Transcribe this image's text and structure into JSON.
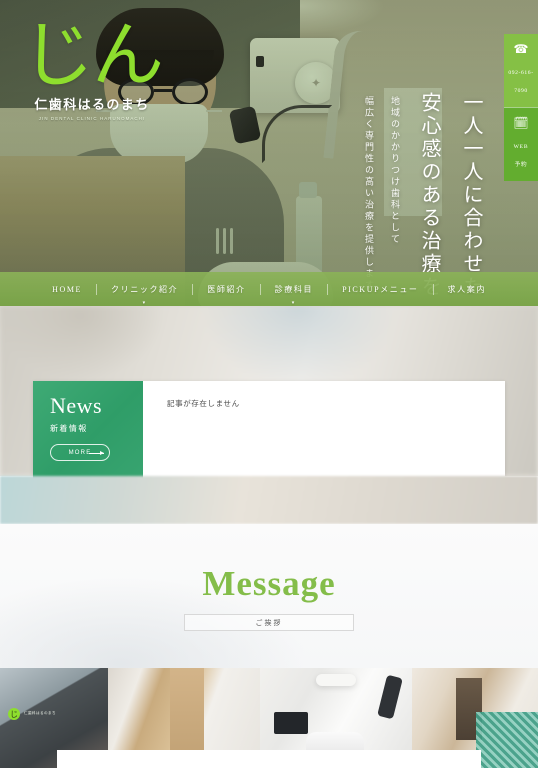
{
  "site": {
    "logo_mark": "じん",
    "clinic_name": "仁歯科はるのまち",
    "clinic_name_roman": "JIN DENTAL CLINIC HARUNOMACHI"
  },
  "hero": {
    "headline_main": "一人一人に合わせた",
    "headline_sub": "安心感のある治療を",
    "lead_line1": "地域のかかりつけ歯科として",
    "lead_line2": "幅広く専門性の高い治療を提供します"
  },
  "rail": {
    "tel_icon": "phone-icon",
    "tel_number": "092-616-7090",
    "web_icon": "calendar-icon",
    "web_label_1": "WEB",
    "web_label_2": "予約"
  },
  "nav": {
    "items": [
      {
        "label": "HOME",
        "has_child": false
      },
      {
        "label": "クリニック紹介",
        "has_child": true
      },
      {
        "label": "医師紹介",
        "has_child": false
      },
      {
        "label": "診療科目",
        "has_child": true
      },
      {
        "label": "PICKUPメニュー",
        "has_child": false
      },
      {
        "label": "求人案内",
        "has_child": false
      }
    ]
  },
  "news": {
    "title": "News",
    "subtitle": "新着情報",
    "more_label": "MORE",
    "empty_text": "記事が存在しません"
  },
  "message": {
    "title": "Message",
    "chip_label": "ご挨拶"
  },
  "gallery": {
    "sign_mark": "じ",
    "sign_text": "仁歯科はるのまち",
    "items": [
      {
        "name": "clinic-exterior"
      },
      {
        "name": "clinic-corridor"
      },
      {
        "name": "treatment-room"
      },
      {
        "name": "reception-counter"
      }
    ]
  },
  "colors": {
    "brand_green": "#8ede2e",
    "nav_green": "#7aa648",
    "news_green": "#2f9d68",
    "message_green": "#84bd4a"
  }
}
